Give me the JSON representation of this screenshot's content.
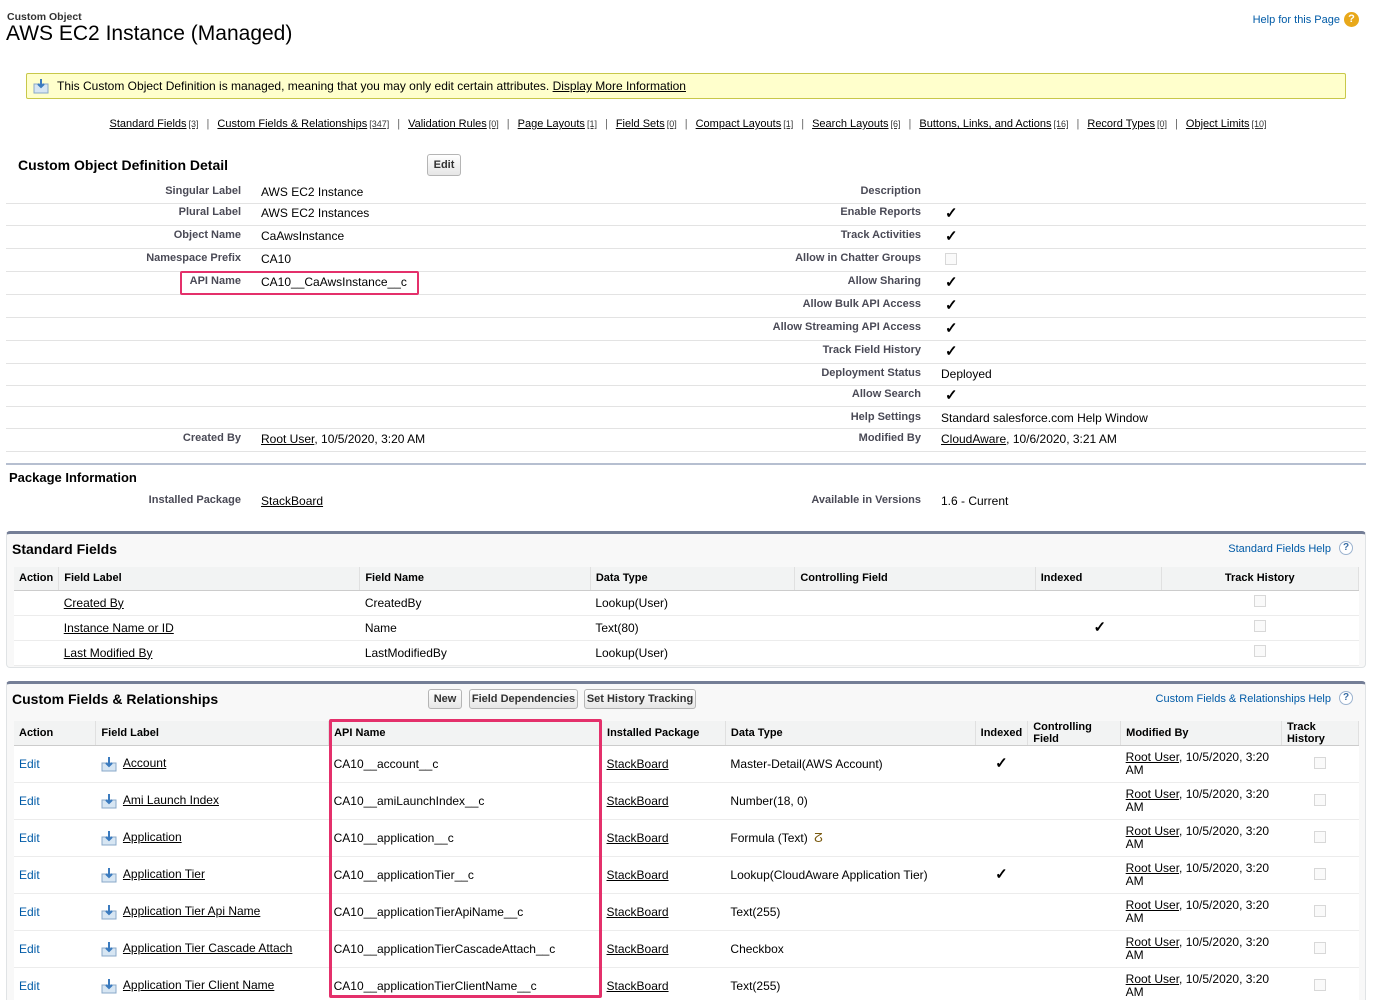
{
  "header": {
    "object_type": "Custom Object",
    "title": "AWS EC2 Instance (Managed)",
    "help_link": "Help for this Page",
    "help_icon_glyph": "?"
  },
  "notice": {
    "text": "This Custom Object Definition is managed, meaning that you may only edit certain attributes.",
    "link": "Display More Information"
  },
  "related_links": [
    {
      "label": "Standard Fields",
      "count": "[3]"
    },
    {
      "label": "Custom Fields & Relationships",
      "count": "[347]"
    },
    {
      "label": "Validation Rules",
      "count": "[0]"
    },
    {
      "label": "Page Layouts",
      "count": "[1]"
    },
    {
      "label": "Field Sets",
      "count": "[0]"
    },
    {
      "label": "Compact Layouts",
      "count": "[1]"
    },
    {
      "label": "Search Layouts",
      "count": "[6]"
    },
    {
      "label": "Buttons, Links, and Actions",
      "count": "[16]"
    },
    {
      "label": "Record Types",
      "count": "[0]"
    },
    {
      "label": "Object Limits",
      "count": "[10]"
    }
  ],
  "detail": {
    "title": "Custom Object Definition Detail",
    "edit_label": "Edit",
    "left": [
      {
        "label": "Singular Label",
        "value": "AWS EC2 Instance"
      },
      {
        "label": "Plural Label",
        "value": "AWS EC2 Instances"
      },
      {
        "label": "Object Name",
        "value": "CaAwsInstance"
      },
      {
        "label": "Namespace Prefix",
        "value": "CA10"
      },
      {
        "label": "API Name",
        "value": "CA10__CaAwsInstance__c"
      }
    ],
    "right": [
      {
        "label": "Description",
        "value": ""
      },
      {
        "label": "Enable Reports",
        "checked": true
      },
      {
        "label": "Track Activities",
        "checked": true
      },
      {
        "label": "Allow in Chatter Groups",
        "checked": false
      },
      {
        "label": "Allow Sharing",
        "checked": true
      },
      {
        "label": "Allow Bulk API Access",
        "checked": true
      },
      {
        "label": "Allow Streaming API Access",
        "checked": true
      },
      {
        "label": "Track Field History",
        "checked": true
      },
      {
        "label": "Deployment Status",
        "value": "Deployed"
      },
      {
        "label": "Allow Search",
        "checked": true
      },
      {
        "label": "Help Settings",
        "value": "Standard salesforce.com Help Window"
      }
    ],
    "created_by_label": "Created By",
    "created_by_user": "Root User",
    "created_by_date": ", 10/5/2020, 3:20 AM",
    "modified_by_label": "Modified By",
    "modified_by_user": "CloudAware",
    "modified_by_date": ", 10/6/2020, 3:21 AM"
  },
  "package": {
    "title": "Package Information",
    "installed_label": "Installed Package",
    "installed_value": "StackBoard",
    "versions_label": "Available in Versions",
    "versions_value": "1.6 - Current"
  },
  "standard_fields": {
    "title": "Standard Fields",
    "help": "Standard Fields Help",
    "columns": [
      "Action",
      "Field Label",
      "Field Name",
      "Data Type",
      "Controlling Field",
      "Indexed",
      "Track History"
    ],
    "rows": [
      {
        "label": "Created By",
        "name": "CreatedBy",
        "type": "Lookup(User)",
        "indexed": false
      },
      {
        "label": "Instance Name or ID",
        "name": "Name",
        "type": "Text(80)",
        "indexed": true
      },
      {
        "label": "Last Modified By",
        "name": "LastModifiedBy",
        "type": "Lookup(User)",
        "indexed": false
      }
    ]
  },
  "custom_fields": {
    "title": "Custom Fields & Relationships",
    "help": "Custom Fields & Relationships Help",
    "buttons": [
      "New",
      "Field Dependencies",
      "Set History Tracking"
    ],
    "columns": [
      "Action",
      "Field Label",
      "API Name",
      "Installed Package",
      "Data Type",
      "Indexed",
      "Controlling Field",
      "Modified By",
      "Track History"
    ],
    "edit_label": "Edit",
    "rows": [
      {
        "label": "Account",
        "api": "CA10__account__c",
        "pkg": "StackBoard",
        "type": "Master-Detail(AWS Account)",
        "indexed": true,
        "user": "Root User",
        "date1": ", 10/5/2020, 3:20",
        "date2": "AM"
      },
      {
        "label": "Ami Launch Index",
        "api": "CA10__amiLaunchIndex__c",
        "pkg": "StackBoard",
        "type": "Number(18, 0)",
        "indexed": false,
        "user": "Root User",
        "date1": ", 10/5/2020, 3:20",
        "date2": "AM"
      },
      {
        "label": "Application",
        "api": "CA10__application__c",
        "pkg": "StackBoard",
        "type": "Formula (Text)",
        "indexed": false,
        "user": "Root User",
        "date1": ", 10/5/2020, 3:20",
        "date2": "AM",
        "formula_icon": "formula-reference-icon"
      },
      {
        "label": "Application Tier",
        "api": "CA10__applicationTier__c",
        "pkg": "StackBoard",
        "type": "Lookup(CloudAware Application Tier)",
        "indexed": true,
        "user": "Root User",
        "date1": ", 10/5/2020, 3:20",
        "date2": "AM"
      },
      {
        "label": "Application Tier Api Name",
        "api": "CA10__applicationTierApiName__c",
        "pkg": "StackBoard",
        "type": "Text(255)",
        "indexed": false,
        "user": "Root User",
        "date1": ", 10/5/2020, 3:20",
        "date2": "AM"
      },
      {
        "label": "Application Tier Cascade Attach",
        "api": "CA10__applicationTierCascadeAttach__c",
        "pkg": "StackBoard",
        "type": "Checkbox",
        "indexed": false,
        "user": "Root User",
        "date1": ", 10/5/2020, 3:20",
        "date2": "AM"
      },
      {
        "label": "Application Tier Client Name",
        "api": "CA10__applicationTierClientName__c",
        "pkg": "StackBoard",
        "type": "Text(255)",
        "indexed": false,
        "user": "Root User",
        "date1": ", 10/5/2020, 3:20",
        "date2": "AM"
      }
    ]
  },
  "colors": {
    "link_blue": "#015ba7",
    "highlight": "#e4306b",
    "notice_bg": "#ffffcc",
    "panel_border": "#747e96"
  }
}
